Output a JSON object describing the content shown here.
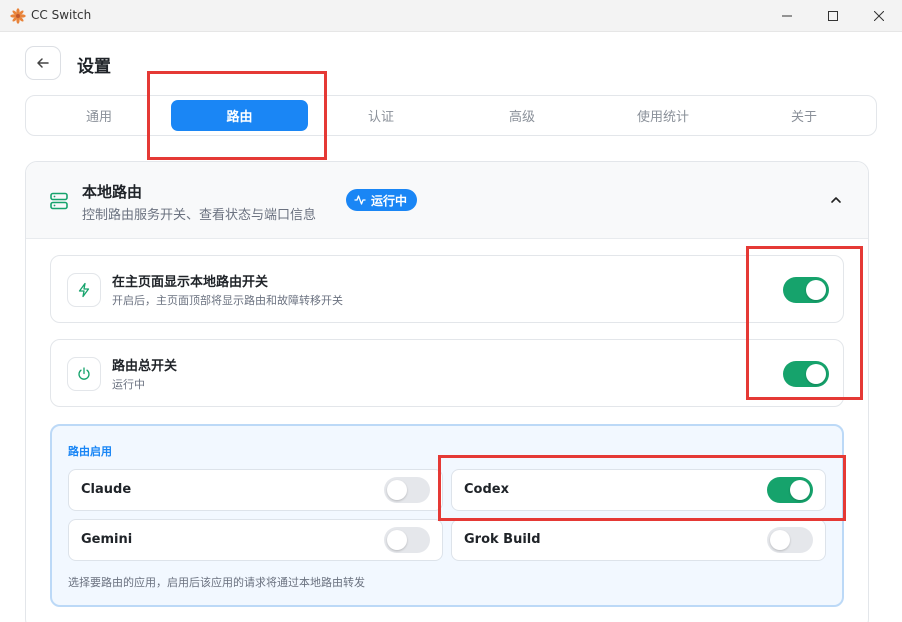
{
  "window": {
    "title": "CC Switch"
  },
  "header": {
    "title": "设置"
  },
  "tabs": [
    {
      "label": "通用",
      "active": false
    },
    {
      "label": "路由",
      "active": true
    },
    {
      "label": "认证",
      "active": false
    },
    {
      "label": "高级",
      "active": false
    },
    {
      "label": "使用统计",
      "active": false
    },
    {
      "label": "关于",
      "active": false
    }
  ],
  "local_routing": {
    "title": "本地路由",
    "subtitle": "控制路由服务开关、查看状态与端口信息",
    "status_badge": "运行中",
    "rows": [
      {
        "title": "在主页面显示本地路由开关",
        "subtitle": "开启后，主页面顶部将显示路由和故障转移开关",
        "enabled": true,
        "icon": "lightning-icon"
      },
      {
        "title": "路由总开关",
        "subtitle": "运行中",
        "enabled": true,
        "icon": "power-icon"
      }
    ],
    "apps_panel": {
      "title": "路由启用",
      "apps": [
        {
          "name": "Claude",
          "enabled": false
        },
        {
          "name": "Codex",
          "enabled": true
        },
        {
          "name": "Gemini",
          "enabled": false
        },
        {
          "name": "Grok Build",
          "enabled": false
        }
      ],
      "note": "选择要路由的应用，启用后该应用的请求将通过本地路由转发"
    }
  },
  "colors": {
    "accent": "#1a86f5",
    "toggle_on": "#16a36c",
    "highlight": "#e53935",
    "icon_green": "#16a36c"
  }
}
